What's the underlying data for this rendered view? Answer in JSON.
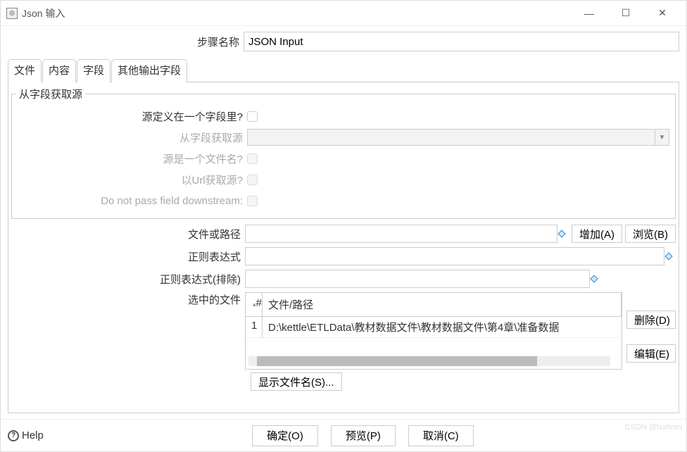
{
  "window": {
    "title": "Json 输入"
  },
  "step": {
    "label": "步骤名称",
    "value": "JSON Input"
  },
  "tabs": {
    "file": "文件",
    "content": "内容",
    "fields": "字段",
    "other": "其他输出字段"
  },
  "source_group": {
    "legend": "从字段获取源",
    "defined_in_field": "源定义在一个字段里?",
    "get_from_field": "从字段获取源",
    "is_filename": "源是一个文件名?",
    "read_url": "以Url获取源?",
    "no_pass": "Do not pass field downstream:"
  },
  "file": {
    "path_label": "文件或路径",
    "regex_label": "正则表达式",
    "regex_exclude_label": "正则表达式(排除)",
    "selected_label": "选中的文件",
    "add_btn": "增加(A)",
    "browse_btn": "浏览(B)",
    "delete_btn": "删除(D)",
    "edit_btn": "编辑(E)",
    "show_btn": "显示文件名(S)..."
  },
  "table": {
    "col_num": "#",
    "col_path": "文件/路径",
    "rows": [
      {
        "num": "1",
        "path": "D:\\kettle\\ETLData\\教材数据文件\\教材数据文件\\第4章\\准备数据"
      }
    ]
  },
  "footer": {
    "help": "Help",
    "ok": "确定(O)",
    "preview": "预览(P)",
    "cancel": "取消(C)"
  },
  "watermark": "CSDN @fxshnrn"
}
